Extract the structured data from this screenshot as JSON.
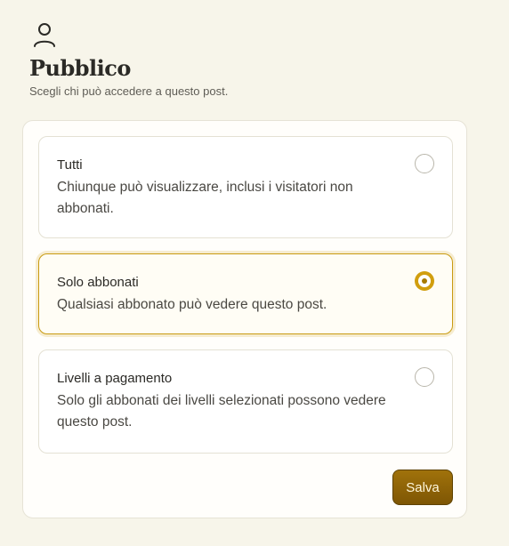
{
  "header": {
    "icon": "user-icon",
    "title": "Pubblico",
    "subtitle": "Scegli chi può accedere a questo post."
  },
  "options": [
    {
      "label": "Tutti",
      "description": "Chiunque può visualizzare, inclusi i visitatori non abbonati.",
      "selected": false
    },
    {
      "label": "Solo abbonati",
      "description": "Qualsiasi abbonato può vedere questo post.",
      "selected": true
    },
    {
      "label": "Livelli a pagamento",
      "description": "Solo gli abbonati dei livelli selezionati possono vedere questo post.",
      "selected": false
    }
  ],
  "actions": {
    "save_label": "Salva"
  },
  "colors": {
    "background": "#f7f5ea",
    "accent": "#d19e0e",
    "button": "#8c6208"
  }
}
